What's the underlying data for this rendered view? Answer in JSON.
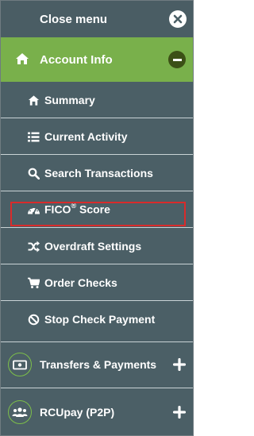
{
  "menu": {
    "close_label": "Close menu",
    "account": {
      "label": "Account Info",
      "items": [
        {
          "label": "Summary",
          "icon": "home-icon"
        },
        {
          "label": "Current Activity",
          "icon": "list-icon"
        },
        {
          "label": "Search Transactions",
          "icon": "search-icon"
        },
        {
          "label": "FICO",
          "sup": "®",
          "suffix": " Score",
          "icon": "gauge-icon",
          "highlighted": true
        },
        {
          "label": "Overdraft Settings",
          "icon": "shuffle-icon"
        },
        {
          "label": "Order Checks",
          "icon": "cart-icon"
        },
        {
          "label": "Stop Check Payment",
          "icon": "ban-icon"
        }
      ]
    },
    "transfers": {
      "label": "Transfers & Payments",
      "icon": "money-icon"
    },
    "rcupay": {
      "label": "RCUpay (P2P)",
      "icon": "people-icon"
    }
  },
  "colors": {
    "menu_bg": "#4b5f66",
    "active_header": "#79b04b",
    "highlight_border": "#d92b2b",
    "ring": "#7dbf4a"
  }
}
